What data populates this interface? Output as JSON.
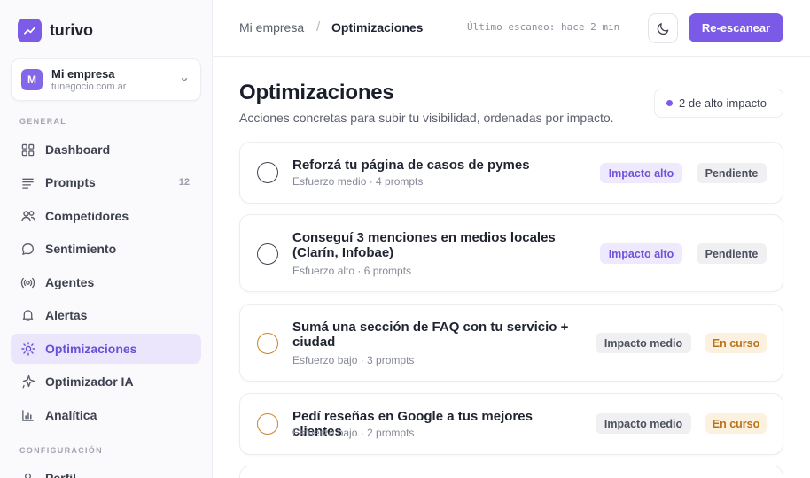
{
  "brand": {
    "name": "turivo",
    "logo_icon": "trend-up-icon",
    "accent_color": "#7c5ce6"
  },
  "workspace": {
    "initial": "M",
    "name": "Mi empresa",
    "domain": "tunegocio.com.ar"
  },
  "sidebar": {
    "general_label": "GENERAL",
    "config_label": "CONFIGURACIÓN",
    "items": [
      {
        "label": "Dashboard",
        "icon": "grid-icon"
      },
      {
        "label": "Prompts",
        "icon": "lines-icon",
        "count": "12"
      },
      {
        "label": "Competidores",
        "icon": "users-icon"
      },
      {
        "label": "Sentimiento",
        "icon": "chat-icon"
      },
      {
        "label": "Agentes",
        "icon": "broadcast-icon"
      },
      {
        "label": "Alertas",
        "icon": "bell-icon"
      },
      {
        "label": "Optimizaciones",
        "icon": "sun-icon",
        "active": true
      },
      {
        "label": "Optimizador IA",
        "icon": "sparkle-icon"
      },
      {
        "label": "Analítica",
        "icon": "bar-chart-icon"
      }
    ],
    "config_items": [
      {
        "label": "Perfil",
        "icon": "user-icon"
      }
    ]
  },
  "header": {
    "breadcrumb_root": "Mi empresa",
    "breadcrumb_separator": "/",
    "breadcrumb_current": "Optimizaciones",
    "last_scan": "Último escaneo: hace 2 min",
    "theme_icon": "moon-icon",
    "rescan_label": "Re-escanear"
  },
  "page": {
    "title": "Optimizaciones",
    "subtitle": "Acciones concretas para subir tu visibilidad, ordenadas por impacto.",
    "impact_summary": "2 de alto impacto"
  },
  "tasks": [
    {
      "title": "Reforzá tu página de casos de pymes",
      "meta": "Esfuerzo medio · 4 prompts",
      "impact": "Impacto alto",
      "status": "Pendiente"
    },
    {
      "title": "Conseguí 3 menciones en medios locales (Clarín, Infobae)",
      "meta": "Esfuerzo alto · 6 prompts",
      "impact": "Impacto alto",
      "status": "Pendiente"
    },
    {
      "title": "Sumá una sección de FAQ con tu servicio + ciudad",
      "meta": "Esfuerzo bajo · 3 prompts",
      "impact": "Impacto medio",
      "status": "En curso"
    },
    {
      "title": "Pedí reseñas en Google a tus mejores clientes",
      "meta": "Esfuerzo bajo · 2 prompts",
      "impact": "Impacto medio",
      "status": "En curso"
    }
  ],
  "colors": {
    "high_impact_bg": "#eee9fc",
    "high_impact_text": "#7152d8",
    "in_progress_bg": "#fcf1de",
    "in_progress_text": "#b8731d",
    "neutral_bg": "#f0f0f3",
    "neutral_text": "#4d5160"
  }
}
